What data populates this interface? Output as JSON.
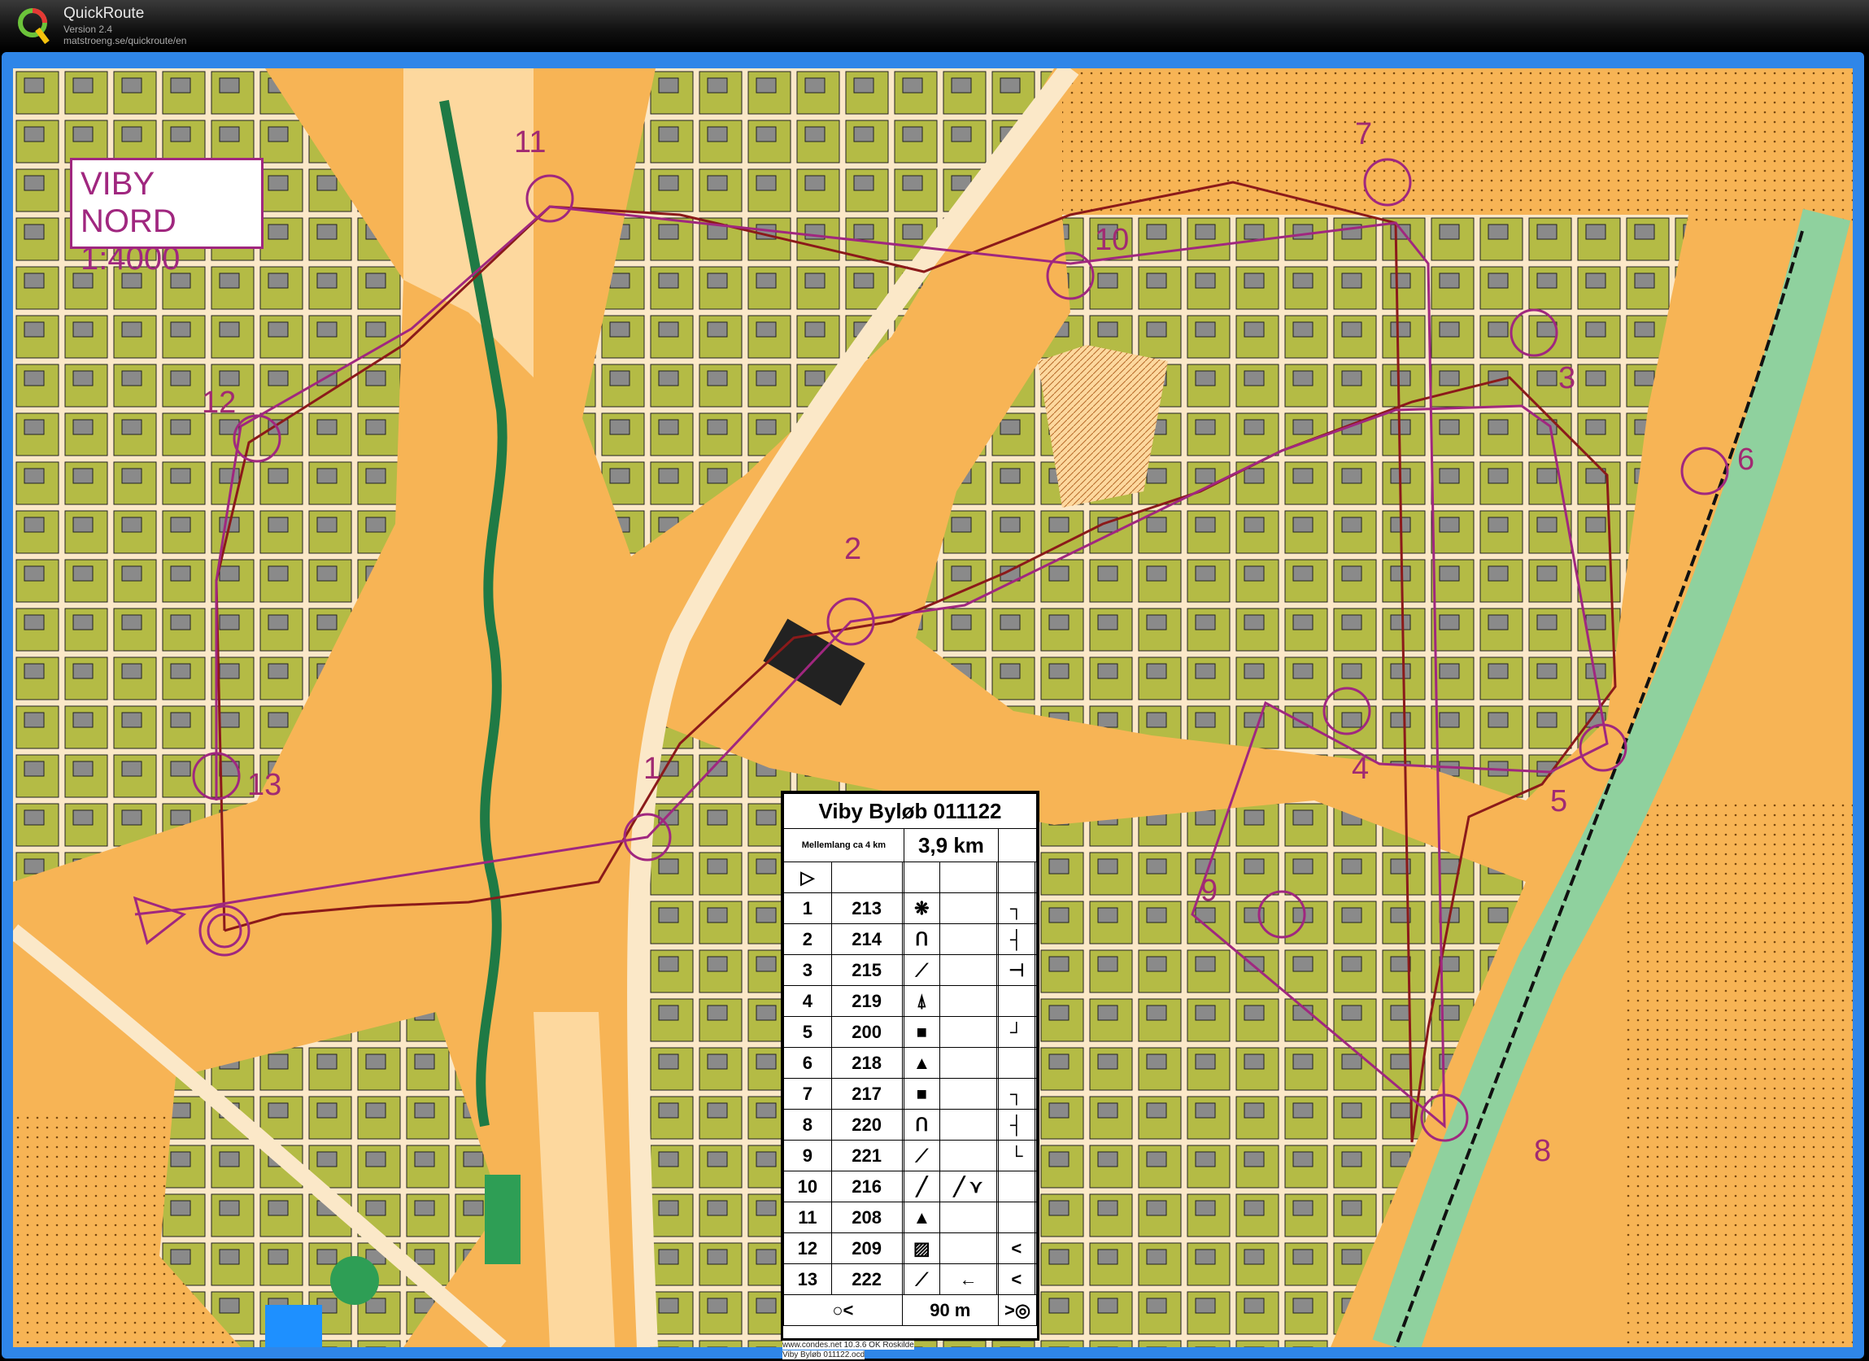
{
  "window": {
    "title": "QuickRoute",
    "version": "Version 2.4",
    "url": "matstroeng.se/quickroute/en"
  },
  "map": {
    "name": "VIBY NORD",
    "scale": "1:4000",
    "colors": {
      "course": "#a0277f",
      "route": "#8b1a1a",
      "open_land": "#f7b455",
      "rough_open": "#fdd89e",
      "urban": "#b8be4a",
      "building": "#8c8c8c",
      "forest": "#1f8a4e",
      "water": "#1e90ff",
      "road": "#fbe8c8"
    },
    "controls": [
      {
        "num": "1"
      },
      {
        "num": "2"
      },
      {
        "num": "3"
      },
      {
        "num": "4"
      },
      {
        "num": "5"
      },
      {
        "num": "6"
      },
      {
        "num": "7"
      },
      {
        "num": "8"
      },
      {
        "num": "9"
      },
      {
        "num": "10"
      },
      {
        "num": "11"
      },
      {
        "num": "12"
      },
      {
        "num": "13"
      }
    ]
  },
  "description_sheet": {
    "title": "Viby Byløb 011122",
    "course": "Mellemlang ca 4 km",
    "length": "3,9 km",
    "start_symbol": "▷",
    "rows": [
      {
        "n": "1",
        "code": "213",
        "feature": "❋",
        "extra": "",
        "detail": "┐"
      },
      {
        "n": "2",
        "code": "214",
        "feature": "ᑎ",
        "extra": "",
        "detail": "┤"
      },
      {
        "n": "3",
        "code": "215",
        "feature": "⟋",
        "extra": "",
        "detail": "⊣"
      },
      {
        "n": "4",
        "code": "219",
        "feature": "⍋",
        "extra": "",
        "detail": ""
      },
      {
        "n": "5",
        "code": "200",
        "feature": "■",
        "extra": "",
        "detail": "┘"
      },
      {
        "n": "6",
        "code": "218",
        "feature": "▲",
        "extra": "",
        "detail": ""
      },
      {
        "n": "7",
        "code": "217",
        "feature": "■",
        "extra": "",
        "detail": "┐"
      },
      {
        "n": "8",
        "code": "220",
        "feature": "ᑎ",
        "extra": "",
        "detail": "┤"
      },
      {
        "n": "9",
        "code": "221",
        "feature": "⟋",
        "extra": "",
        "detail": "└"
      },
      {
        "n": "10",
        "code": "216",
        "feature": "╱",
        "extra": "╱ ⋎",
        "detail": ""
      },
      {
        "n": "11",
        "code": "208",
        "feature": "▲",
        "extra": "",
        "detail": ""
      },
      {
        "n": "12",
        "code": "209",
        "feature": "▨",
        "extra": "",
        "detail": "<"
      },
      {
        "n": "13",
        "code": "222",
        "feature": "⟋",
        "extra": "←",
        "detail": "<"
      }
    ],
    "finish_distance": "90 m",
    "finish_left": "○<",
    "finish_right": ">◎"
  },
  "footer": {
    "line1": "www.condes.net 10.3.6 OK Roskilde",
    "line2": "Viby Byløb 011122.ocd"
  }
}
